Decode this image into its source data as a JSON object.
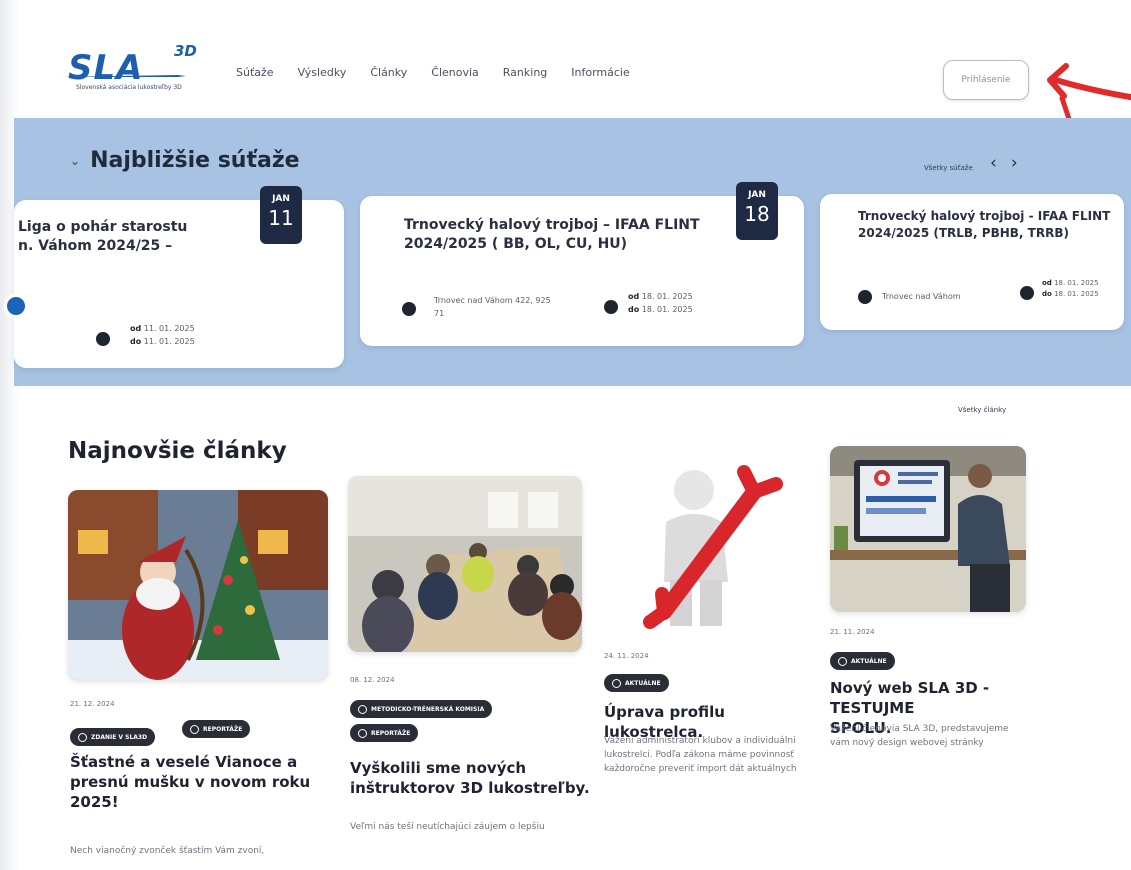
{
  "header": {
    "logo_text": "SLA",
    "logo_sup": "3D",
    "logo_sub": "Slovenská asociácia lukostreľby 3D",
    "nav": [
      "Súťaže",
      "Výsledky",
      "Články",
      "Členovia",
      "Ranking",
      "Informácie"
    ],
    "login_label": "Prihlásenie"
  },
  "upcoming": {
    "title": "Najbližšie súťaže",
    "all_link": "Všetky súťaže",
    "cards": [
      {
        "title": "Liga o pohár starostu\nn. Váhom 2024/25 –",
        "month": "JAN",
        "day": "11",
        "from_label": "od",
        "from": "11. 01. 2025",
        "to_label": "do",
        "to": "11. 01. 2025"
      },
      {
        "title": "Trnovecký halový trojboj – IFAA FLINT\n2024/2025 ( BB, OL, CU, HU)",
        "month": "JAN",
        "day": "18",
        "location": "Trnovec nad Váhom 422, 925\n71",
        "from_label": "od",
        "from": "18. 01. 2025",
        "to_label": "do",
        "to": "18. 01. 2025"
      },
      {
        "title": "Trnovecký halový trojboj - IFAA FLINT\n2024/2025 (TRLB, PBHB, TRRB)",
        "location": "Trnovec nad Váhom",
        "from_label": "od",
        "from": "18. 01. 2025",
        "to_label": "do",
        "to": "18. 01. 2025"
      }
    ]
  },
  "articles": {
    "title": "Najnovšie články",
    "all_link": "Všetky články",
    "items": [
      {
        "date": "21. 12. 2024",
        "tags": [
          "ZDANIE V SLA3D",
          "REPORTÁŽE"
        ],
        "title": "Šťastné a veselé Vianoce a\npresnú mušku v novom roku\n2025!",
        "excerpt": "Nech vianočný zvonček šťastím Vám zvoní,"
      },
      {
        "date": "08. 12. 2024",
        "tags": [
          "METODICKO-TRÉNERSKÁ KOMISIA",
          "REPORTÁŽE"
        ],
        "title": "Vyškolili sme nových\ninštruktorov 3D lukostreľby.",
        "excerpt": "Veľmi nás teší neutíchajúci záujem o lepšiu"
      },
      {
        "date": "24. 11. 2024",
        "tags": [
          "AKTUÁLNE"
        ],
        "title": "Úprava profilu lukostrelca.",
        "excerpt": "Vážení administrátori klubov a individuálni\nlukostrelci. Podľa zákona máme povinnosť\nkaždoročne preveriť import dát aktuálnych"
      },
      {
        "date": "21. 11. 2024",
        "tags": [
          "AKTUÁLNE"
        ],
        "title": "Nový web SLA 3D - TESTUJME\nSPOLU.",
        "excerpt": "Vážení členovia SLA 3D, predstavujeme\nvám nový design webovej stránky"
      }
    ]
  }
}
